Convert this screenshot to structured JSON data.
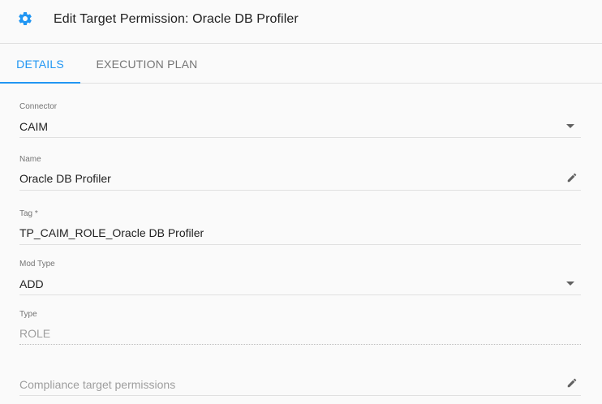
{
  "header": {
    "title": "Edit Target Permission: Oracle DB Profiler",
    "icon": "gear-icon",
    "icon_color": "#2196f3"
  },
  "tabs": [
    {
      "label": "DETAILS",
      "active": true
    },
    {
      "label": "EXECUTION PLAN",
      "active": false
    }
  ],
  "fields": {
    "connector": {
      "label": "Connector",
      "value": "CAIM"
    },
    "name": {
      "label": "Name",
      "value": "Oracle DB Profiler"
    },
    "tag": {
      "label": "Tag *",
      "value": "TP_CAIM_ROLE_Oracle DB Profiler"
    },
    "mod_type": {
      "label": "Mod Type",
      "value": "ADD"
    },
    "type": {
      "label": "Type",
      "value": "ROLE"
    },
    "compliance": {
      "placeholder": "Compliance target permissions"
    }
  },
  "colors": {
    "accent": "#2196f3"
  }
}
